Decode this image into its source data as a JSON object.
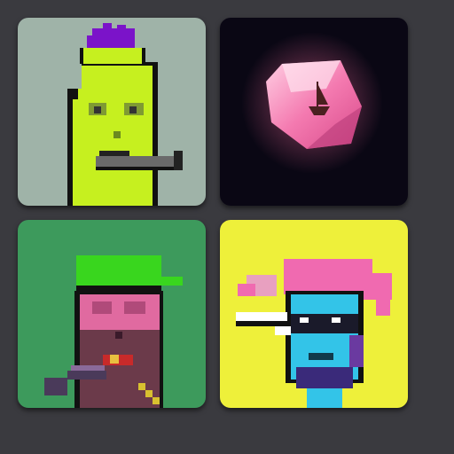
{
  "tiles": [
    {
      "id": "green-alien-punk",
      "background": "#9fb3a8",
      "skin": "#c6f01f",
      "hair": "#7b13c9",
      "cigarette": "#6a6a6a"
    },
    {
      "id": "pink-crystal-gem",
      "background": "#0a0714",
      "gem": "#f47ab0",
      "glow": "#ff6fa0"
    },
    {
      "id": "pink-mask-punk",
      "background": "#3d9a5c",
      "cap": "#39d61e",
      "skin": "#e06aa0",
      "pipe": "#4a3a5a"
    },
    {
      "id": "blue-pigtail-punk",
      "background": "#eef03a",
      "hair": "#f06ab0",
      "skin": "#33c4e8",
      "shades": "#1a1a2a"
    }
  ]
}
